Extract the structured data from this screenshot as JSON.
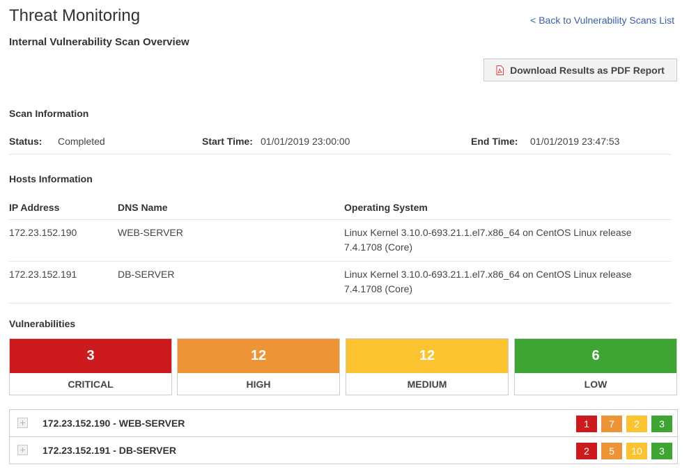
{
  "header": {
    "title": "Threat Monitoring",
    "subtitle": "Internal Vulnerability Scan Overview",
    "back_link": "< Back to Vulnerability Scans List",
    "download_button": "Download Results as PDF Report",
    "download_icon": "pdf-file-icon"
  },
  "scan_info": {
    "section_title": "Scan Information",
    "status_label": "Status:",
    "status_value": "Completed",
    "start_label": "Start Time:",
    "start_value": "01/01/2019 23:00:00",
    "end_label": "End Time:",
    "end_value": "01/01/2019 23:47:53"
  },
  "hosts_info": {
    "section_title": "Hosts Information",
    "columns": [
      "IP Address",
      "DNS Name",
      "Operating System"
    ],
    "rows": [
      {
        "ip": "172.23.152.190",
        "dns": "WEB-SERVER",
        "os": "Linux Kernel 3.10.0-693.21.1.el7.x86_64 on CentOS Linux release 7.4.1708 (Core)"
      },
      {
        "ip": "172.23.152.191",
        "dns": "DB-SERVER",
        "os": "Linux Kernel 3.10.0-693.21.1.el7.x86_64 on CentOS Linux release 7.4.1708 (Core)"
      }
    ]
  },
  "vulnerabilities": {
    "section_title": "Vulnerabilities",
    "severities": [
      {
        "name": "CRITICAL",
        "count": "3",
        "color": "#cc1a1e"
      },
      {
        "name": "HIGH",
        "count": "12",
        "color": "#ed9436"
      },
      {
        "name": "MEDIUM",
        "count": "12",
        "color": "#fbc330"
      },
      {
        "name": "LOW",
        "count": "6",
        "color": "#3ea535"
      }
    ],
    "hosts": [
      {
        "title": "172.23.152.190 - WEB-SERVER",
        "expand_icon": "plus-square-icon",
        "counts": [
          "1",
          "7",
          "2",
          "3"
        ]
      },
      {
        "title": "172.23.152.191 - DB-SERVER",
        "expand_icon": "plus-square-icon",
        "counts": [
          "2",
          "5",
          "10",
          "3"
        ]
      }
    ]
  }
}
